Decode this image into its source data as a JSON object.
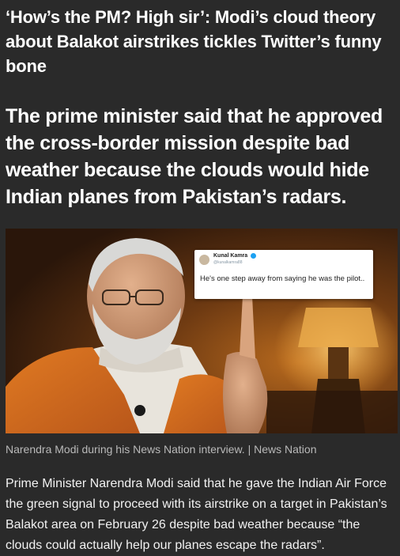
{
  "article": {
    "headline": "‘How’s the PM? High sir’: Modi’s cloud theory about Balakot airstrikes tickles Twitter’s funny bone",
    "subheadline": "The prime minister said that he approved the cross-border mission despite bad weather because the clouds would hide Indian planes from Pakistan’s radars.",
    "caption": "Narendra Modi during his News Nation interview. | News Nation",
    "body": "Prime Minister Narendra Modi said that he gave the Indian Air Force the green signal to proceed with its airstrike on a target in Pakistan’s Balakot area on February 26 despite bad weather because “the clouds could actually help our planes escape the radars”."
  },
  "tweet": {
    "author_name": "Kunal Kamra",
    "handle": "@kunalkamra88",
    "text": "He's one step away from saying he was the pilot.."
  },
  "colors": {
    "page_background": "#2a2a2a",
    "text_primary": "#ffffff",
    "caption_text": "#b9b9b9",
    "verified_badge": "#1da1f2"
  },
  "icons": {
    "verified": "verified-badge-icon"
  }
}
